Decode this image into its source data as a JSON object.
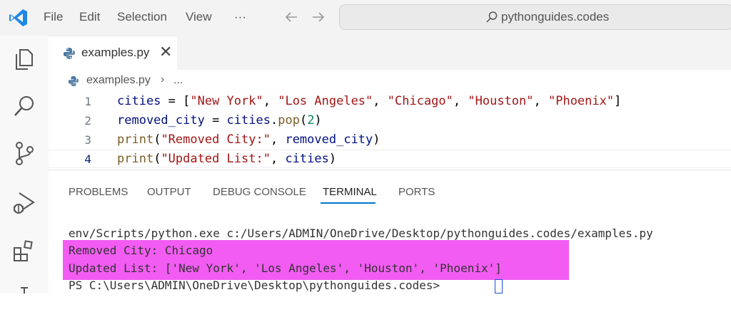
{
  "menu": {
    "file": "File",
    "edit": "Edit",
    "selection": "Selection",
    "view": "View",
    "more": "···"
  },
  "search": {
    "text": "pythonguides.codes"
  },
  "editor": {
    "tab_label": "examples.py",
    "close_glyph": "✕",
    "breadcrumb": {
      "file": "examples.py",
      "separator": "›",
      "more": "..."
    },
    "lines": [
      {
        "number": "1"
      },
      {
        "number": "2"
      },
      {
        "number": "3"
      },
      {
        "number": "4"
      }
    ]
  },
  "code_tokens": {
    "l1_cities": "cities",
    "l1_eq": " = [",
    "l1_s1": "\"New York\"",
    "l1_c1": ", ",
    "l1_s2": "\"Los Angeles\"",
    "l1_c2": ", ",
    "l1_s3": "\"Chicago\"",
    "l1_c3": ", ",
    "l1_s4": "\"Houston\"",
    "l1_c4": ", ",
    "l1_s5": "\"Phoenix\"",
    "l1_end": "]",
    "l2_var": "removed_city",
    "l2_eq": " = ",
    "l2_cities": "cities",
    "l2_dot": ".",
    "l2_pop": "pop",
    "l2_open": "(",
    "l2_num": "2",
    "l2_close": ")",
    "l3_print": "print",
    "l3_open": "(",
    "l3_str": "\"Removed City:\"",
    "l3_comma": ", ",
    "l3_var": "removed_city",
    "l3_close": ")",
    "l4_print": "print",
    "l4_open": "(",
    "l4_str": "\"Updated List:\"",
    "l4_comma": ", ",
    "l4_var": "cities",
    "l4_close": ")"
  },
  "panel": {
    "tabs": [
      "PROBLEMS",
      "OUTPUT",
      "DEBUG CONSOLE",
      "TERMINAL",
      "PORTS"
    ],
    "active_tab": "TERMINAL"
  },
  "terminal": {
    "line1": "env/Scripts/python.exe c:/Users/ADMIN/OneDrive/Desktop/pythonguides.codes/examples.py",
    "line2": "Removed City: Chicago",
    "line3": "Updated List: ['New York', 'Los Angeles', 'Houston', 'Phoenix']",
    "line4": "PS C:\\Users\\ADMIN\\OneDrive\\Desktop\\pythonguides.codes> "
  },
  "colors": {
    "highlight": "#f25cf2",
    "accent": "#007acc",
    "vscode_logo": "#1e88e5"
  }
}
